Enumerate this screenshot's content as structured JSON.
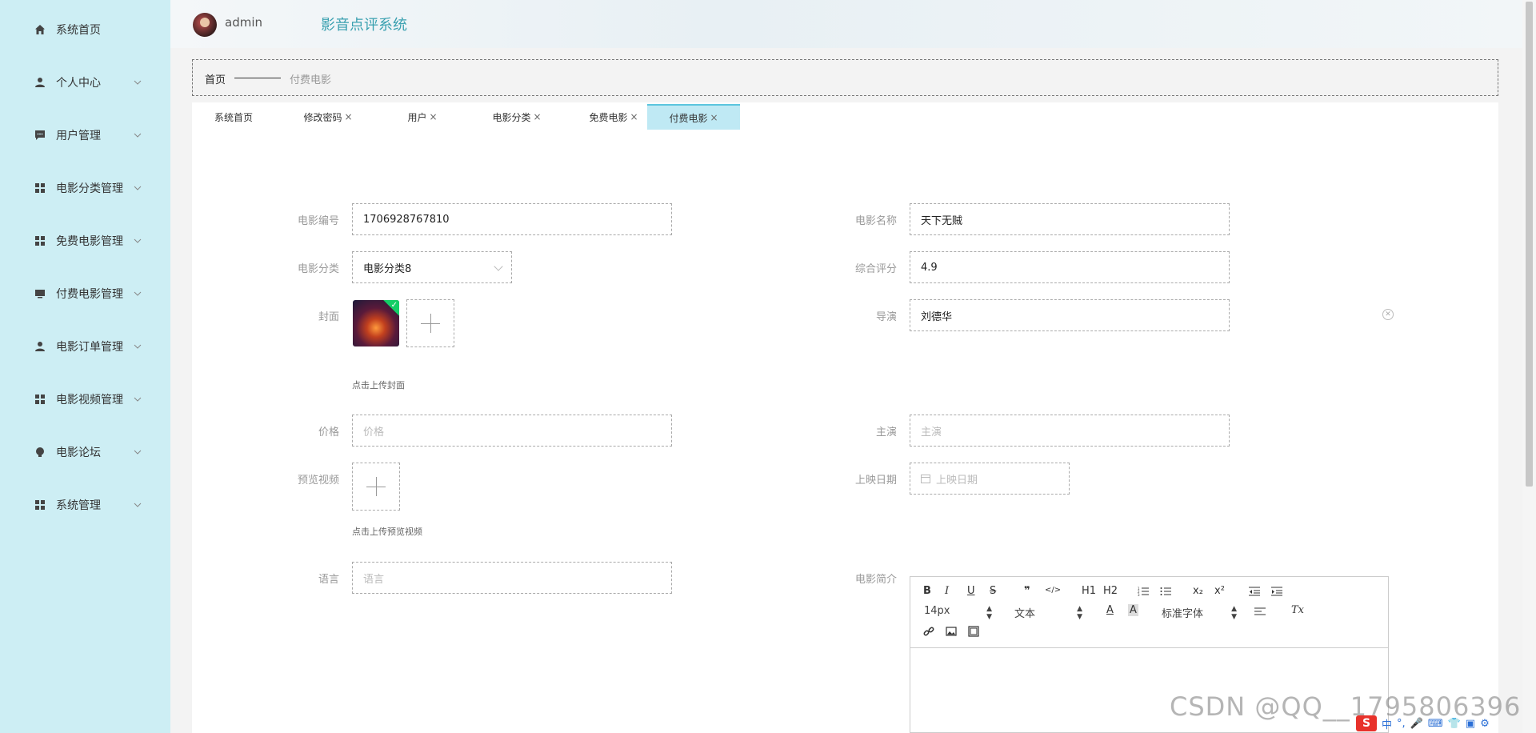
{
  "sidebar": {
    "items": [
      {
        "label": "系统首页",
        "icon": "home-icon",
        "has_children": false
      },
      {
        "label": "个人中心",
        "icon": "person-icon",
        "has_children": true
      },
      {
        "label": "用户管理",
        "icon": "chat-icon",
        "has_children": true
      },
      {
        "label": "电影分类管理",
        "icon": "grid-icon",
        "has_children": true
      },
      {
        "label": "免费电影管理",
        "icon": "grid-icon",
        "has_children": true
      },
      {
        "label": "付费电影管理",
        "icon": "monitor-icon",
        "has_children": true
      },
      {
        "label": "电影订单管理",
        "icon": "person-icon",
        "has_children": true
      },
      {
        "label": "电影视频管理",
        "icon": "grid-icon",
        "has_children": true
      },
      {
        "label": "电影论坛",
        "icon": "bulb-icon",
        "has_children": true
      },
      {
        "label": "系统管理",
        "icon": "grid-icon",
        "has_children": true
      }
    ]
  },
  "header": {
    "username": "admin",
    "app_title": "影音点评系统"
  },
  "breadcrumb": {
    "home": "首页",
    "current": "付费电影"
  },
  "tabs": [
    {
      "label": "系统首页",
      "closable": false,
      "active": false
    },
    {
      "label": "修改密码",
      "closable": true,
      "active": false
    },
    {
      "label": "用户",
      "closable": true,
      "active": false
    },
    {
      "label": "电影分类",
      "closable": true,
      "active": false
    },
    {
      "label": "免费电影",
      "closable": true,
      "active": false
    },
    {
      "label": "付费电影",
      "closable": true,
      "active": true
    }
  ],
  "tab_close_glyph": "×",
  "form": {
    "movie_no": {
      "label": "电影编号",
      "value": "1706928767810"
    },
    "movie_name": {
      "label": "电影名称",
      "value": "天下无贼"
    },
    "category": {
      "label": "电影分类",
      "value": "电影分类8"
    },
    "rating": {
      "label": "综合评分",
      "value": "4.9"
    },
    "cover": {
      "label": "封面",
      "hint": "点击上传封面"
    },
    "director": {
      "label": "导演",
      "value": "刘德华"
    },
    "price": {
      "label": "价格",
      "placeholder": "价格"
    },
    "actor": {
      "label": "主演",
      "placeholder": "主演"
    },
    "preview_video": {
      "label": "预览视频",
      "hint": "点击上传预览视频"
    },
    "release_date": {
      "label": "上映日期",
      "placeholder": "上映日期"
    },
    "language": {
      "label": "语言",
      "placeholder": "语言"
    },
    "intro": {
      "label": "电影简介"
    }
  },
  "editor": {
    "row1": [
      "B",
      "I",
      "U",
      "S",
      "❞",
      "</>",
      "H1",
      "H2",
      "ol",
      "ul",
      "x₂",
      "x²",
      "outdent",
      "indent"
    ],
    "font_size": "14px",
    "block_type": "文本",
    "font_family": "标准字体",
    "clear_format": "Tx"
  },
  "watermark": "CSDN @QQ__1795806396",
  "tray": {
    "ime": "中"
  },
  "colors": {
    "sidebar_bg": "#cdeef4",
    "accent": "#3aa0b0",
    "active_tab": "#bfe9f4",
    "success": "#13ce66"
  }
}
